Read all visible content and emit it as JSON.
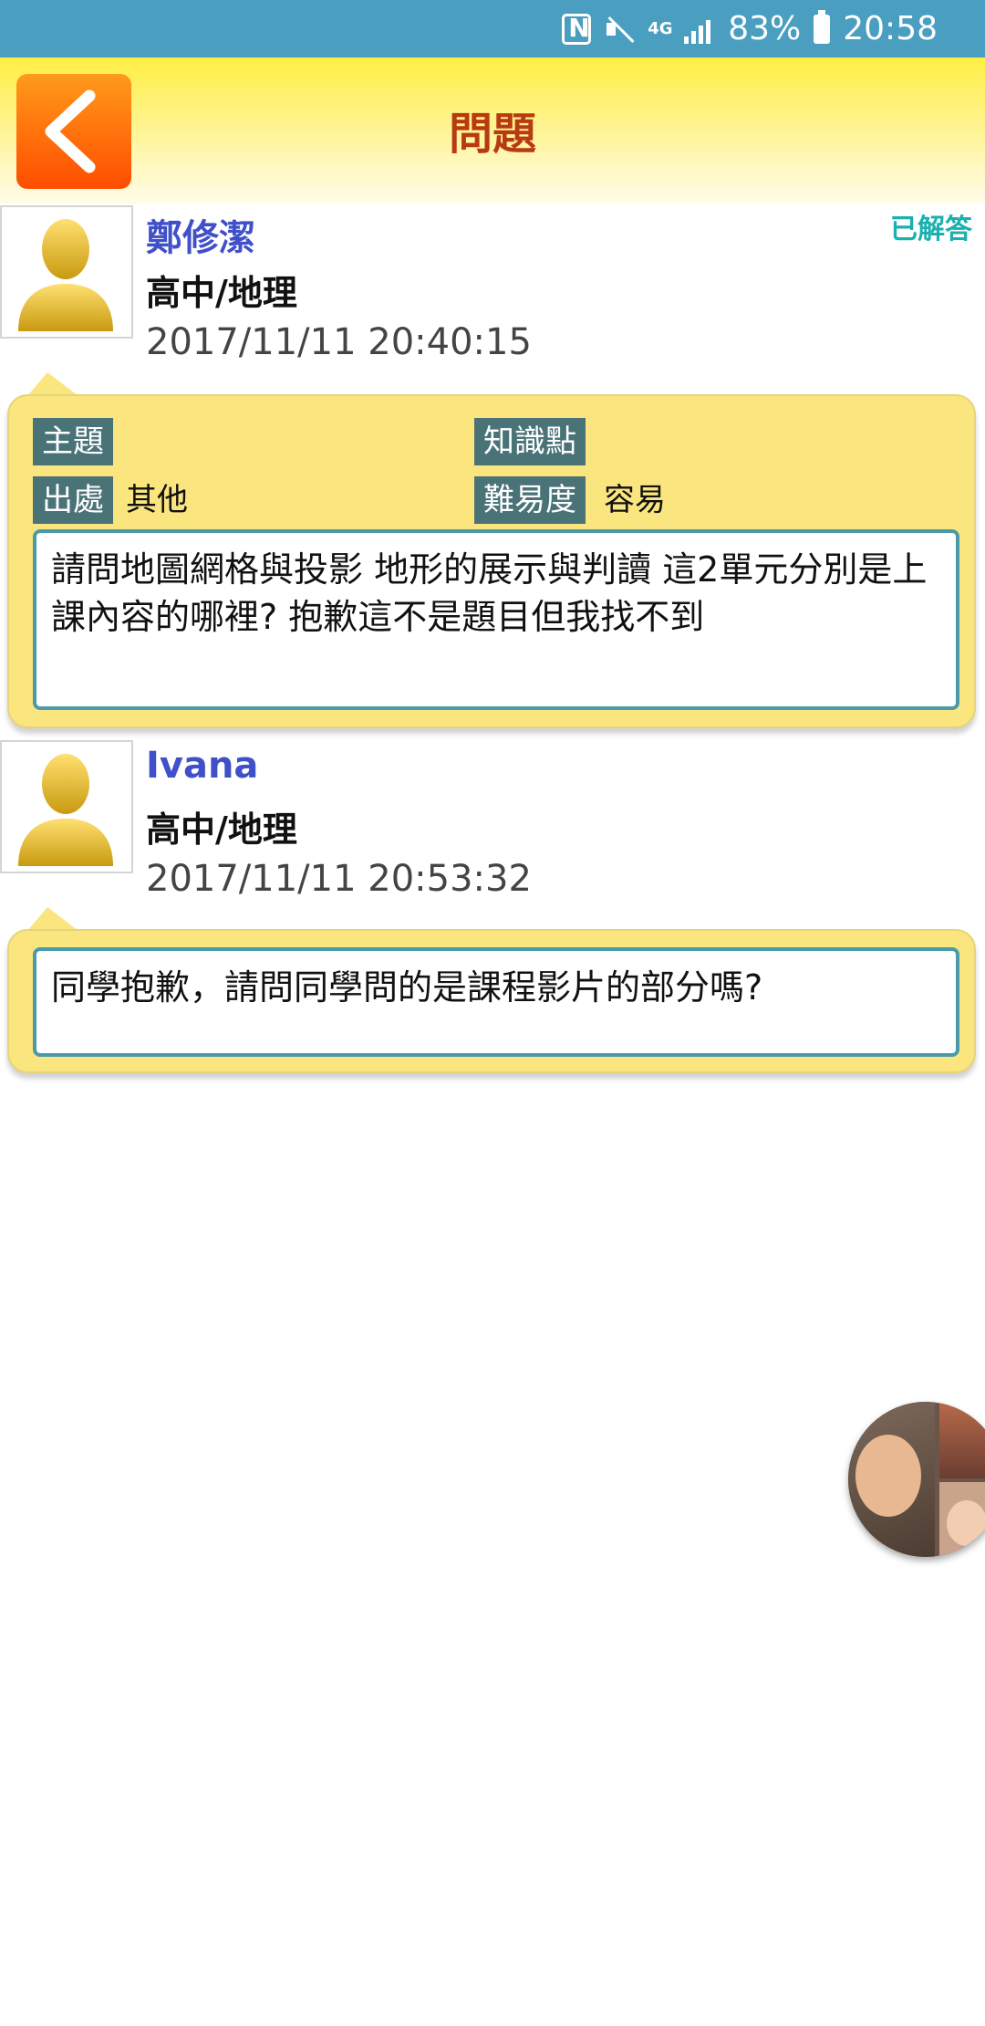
{
  "status_bar": {
    "network": "4G",
    "battery": "83%",
    "time": "20:58"
  },
  "header": {
    "title": "問題",
    "back_icon": "chevron-left-icon"
  },
  "question": {
    "user_name": "鄭修潔",
    "subject": "高中/地理",
    "timestamp": "2017/11/11 20:40:15",
    "status": "已解答",
    "tags": {
      "topic_label": "主題",
      "topic_value": "",
      "knowledge_label": "知識點",
      "knowledge_value": "",
      "source_label": "出處",
      "source_value": "其他",
      "difficulty_label": "難易度",
      "difficulty_value": "容易"
    },
    "body": "請問地圖網格與投影 地形的展示與判讀 這2單元分別是上課內容的哪裡? 抱歉這不是題目但我找不到"
  },
  "reply": {
    "user_name": "Ivana",
    "subject": "高中/地理",
    "timestamp": "2017/11/11 20:53:32",
    "body": "同學抱歉，請問同學問的是課程影片的部分嗎?"
  },
  "colors": {
    "status_bar": "#4a9ec0",
    "header_yellow": "#ffee44",
    "title_text": "#b83a12",
    "user_name": "#4050c8",
    "status_badge": "#1ab0b0",
    "bubble": "#fae57f",
    "tag_bg": "#4a7378",
    "qbox_border": "#4a9aaa"
  }
}
